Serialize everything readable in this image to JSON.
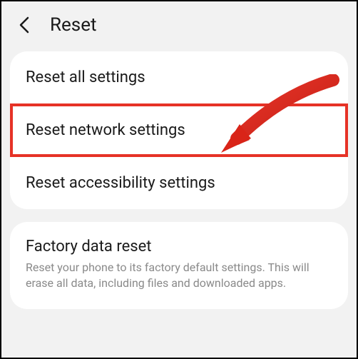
{
  "header": {
    "title": "Reset"
  },
  "settings_group": {
    "items": [
      {
        "label": "Reset all settings"
      },
      {
        "label": "Reset network settings"
      },
      {
        "label": "Reset accessibility settings"
      }
    ]
  },
  "factory_group": {
    "title": "Factory data reset",
    "description": "Reset your phone to its factory default settings. This will erase all data, including files and downloaded apps."
  },
  "annotation": {
    "highlight_color": "#e63226",
    "arrow_color": "#d92418"
  }
}
